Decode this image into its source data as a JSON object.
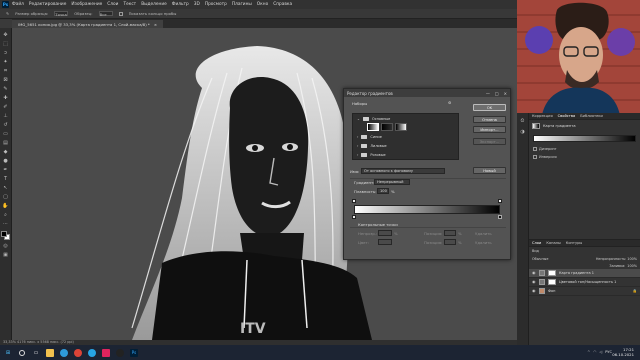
{
  "app": {
    "logo": "Ps"
  },
  "menu": [
    "Файл",
    "Редактирование",
    "Изображение",
    "Слои",
    "Текст",
    "Выделение",
    "Фильтр",
    "3D",
    "Просмотр",
    "Плагины",
    "Окно",
    "Справка"
  ],
  "options": {
    "size_label": "Размер образца:",
    "size_value": "Точка",
    "sample_label": "Образец:",
    "sample_value": "Все слои",
    "ring_label": "Показать кольцо пробы"
  },
  "document_tab": {
    "title": "IMG_5651 копия.jpg @ 33,3% (Карта градиента 1, Слой-маска/8) *"
  },
  "status": {
    "zoom": "33,33%",
    "info": "4176 пикс. x 5568 пикс. (72 ppi)"
  },
  "dialog": {
    "title": "Редактор градиентов",
    "presets_label": "Наборы",
    "folders": [
      "Основные",
      "Синие",
      "Лиловые",
      "Розовые"
    ],
    "ok": "OK",
    "cancel": "Отмена",
    "import": "Импорт...",
    "export": "Экспорт...",
    "name_label": "Имя:",
    "name_value": "От основного к фоновому",
    "new_button": "Новый",
    "type_label": "Градиент:",
    "type_value": "Непрерывный",
    "smooth_label": "Плавность:",
    "smooth_value": "100",
    "smooth_unit": "%",
    "stops_label": "Контрольные точки",
    "opacity_label": "Непрозр.:",
    "color_label": "Цвет:",
    "location_label": "Позиция:",
    "percent": "%",
    "delete_label": "Удалить"
  },
  "properties": {
    "tabs": [
      "Коррекция",
      "Свойства",
      "Библиотеки"
    ],
    "title": "Карта градиента",
    "dither": "Дизеринг",
    "reverse": "Инверсия"
  },
  "layers": {
    "tabs": [
      "Слои",
      "Каналы",
      "Контуры"
    ],
    "kind_label": "Вид",
    "blend_mode": "Обычные",
    "opacity_label": "Непрозрачность:",
    "opacity_value": "100%",
    "fill_label": "Заливка:",
    "fill_value": "100%",
    "items": [
      "Карта градиента 1",
      "Цветовой тон/Насыщенность 1",
      "Фон"
    ]
  },
  "taskbar": {
    "lang": "РУС",
    "time": "17:21",
    "date": "06.10.2021"
  },
  "colors": {
    "foreground": "#000000",
    "background": "#ffffff"
  }
}
